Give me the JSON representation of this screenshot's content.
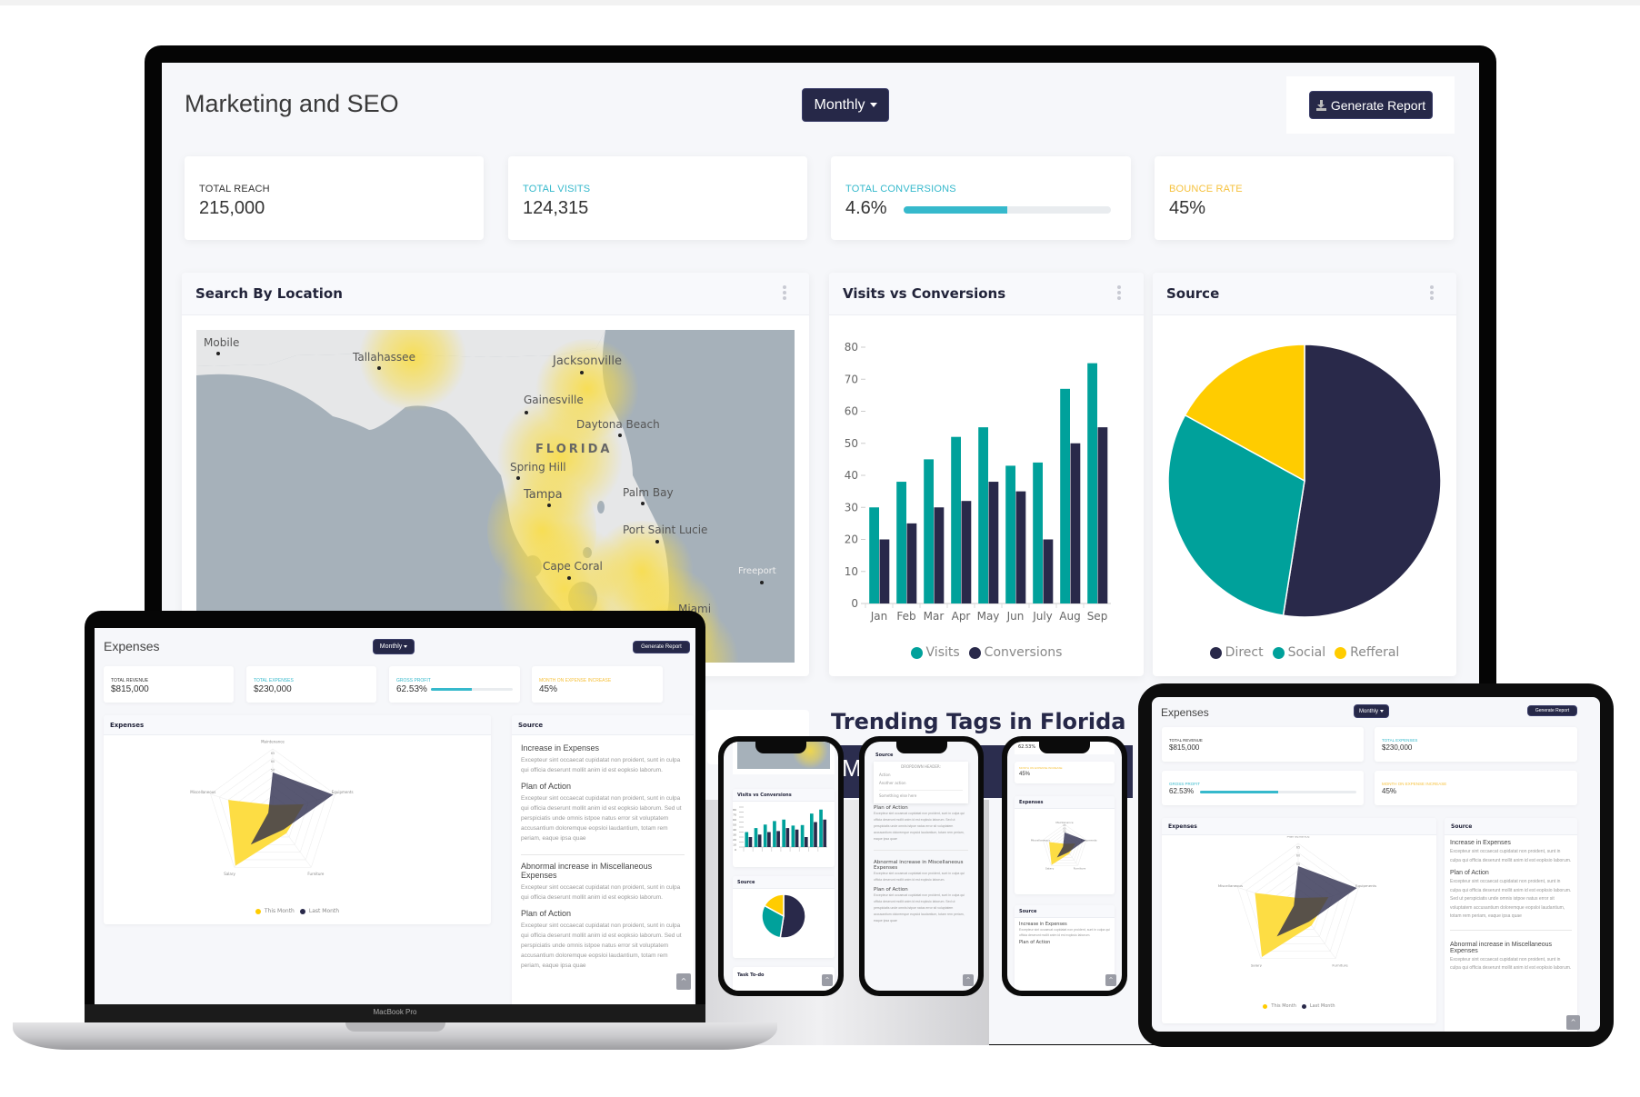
{
  "monitor": {
    "title": "Marketing and SEO",
    "period_button": "Monthly",
    "generate_button": "Generate Report",
    "stats": [
      {
        "label": "TOTAL REACH",
        "value": "215,000",
        "color": "#333333"
      },
      {
        "label": "TOTAL VISITS",
        "value": "124,315",
        "color": "#36b9cc"
      },
      {
        "label": "TOTAL CONVERSIONS",
        "value": "4.6%",
        "color": "#36b9cc",
        "progress_percent": 50
      },
      {
        "label": "BOUNCE RATE",
        "value": "45%",
        "color": "#f6c23e"
      }
    ],
    "map_panel": {
      "title": "Search By Location",
      "state_label": "FLORIDA",
      "cities": [
        "Mobile",
        "Tallahassee",
        "Jacksonville",
        "Gainesville",
        "Daytona Beach",
        "Spring Hill",
        "Tampa",
        "Palm Bay",
        "Port Saint Lucie",
        "Cape Coral",
        "Freeport",
        "Miami"
      ]
    },
    "trending": {
      "title": "Trending Tags in Florida",
      "banner_text": "M"
    }
  },
  "chart_data": [
    {
      "type": "bar",
      "title": "Visits vs Conversions",
      "categories": [
        "Jan",
        "Feb",
        "Mar",
        "Apr",
        "May",
        "Jun",
        "July",
        "Aug",
        "Sep"
      ],
      "series": [
        {
          "name": "Visits",
          "color": "#00a19b",
          "values": [
            30,
            38,
            45,
            52,
            55,
            43,
            44,
            67,
            75
          ]
        },
        {
          "name": "Conversions",
          "color": "#29294a",
          "values": [
            20,
            25,
            30,
            32,
            38,
            35,
            20,
            50,
            55
          ]
        }
      ],
      "yticks": [
        0,
        10,
        20,
        30,
        40,
        50,
        60,
        70,
        80
      ],
      "ylim": [
        0,
        80
      ],
      "legend": "bottom",
      "xlabel": "",
      "ylabel": ""
    },
    {
      "type": "pie",
      "title": "Source",
      "labels": [
        "Direct",
        "Social",
        "Refferal"
      ],
      "values": [
        52.5,
        30.5,
        17
      ],
      "colors": [
        "#29294a",
        "#00a19b",
        "#ffcc00"
      ],
      "legend": "bottom"
    },
    {
      "type": "radar",
      "title": "Expenses",
      "axes": [
        "Maintenance",
        "Equipments",
        "Furniture",
        "Salary",
        "Miscellaneous"
      ],
      "rticks": [
        50,
        60,
        65
      ],
      "series": [
        {
          "name": "This Month",
          "color": "#fddb3a",
          "values": [
            10,
            35,
            25,
            68,
            50
          ]
        },
        {
          "name": "Last Month",
          "color": "#29294a",
          "values": [
            45,
            68,
            20,
            40,
            5
          ]
        }
      ],
      "legend": "bottom"
    }
  ],
  "expenses_dashboard": {
    "title": "Expenses",
    "period_button": "Monthly",
    "generate_button": "Generate Report",
    "stats": [
      {
        "label": "TOTAL REVENUE",
        "value": "$815,000",
        "color": "#333333"
      },
      {
        "label": "TOTAL EXPENSES",
        "value": "$230,000",
        "color": "#36b9cc"
      },
      {
        "label": "GROSS PROFIT",
        "value": "62.53%",
        "color": "#36b9cc",
        "progress_percent": 50
      },
      {
        "label": "MONTH ON EXPENSE INCREASE",
        "value": "45%",
        "color": "#f6c23e"
      }
    ],
    "chart_panel_title": "Expenses",
    "source_panel": {
      "title": "Source",
      "sections": [
        {
          "heading": "Increase in Expenses",
          "body": "Excepteur sint occaecat cupidatat non proident, sunt in culpa qui officia deserunt mollit anim id est eopksio laborum."
        },
        {
          "heading": "Plan of Action",
          "body": "Excepteur sint occaecat cupidatat non proident, sunt in culpa qui officia deserunt mollit anim id est eopksio laborum. Sed ut perspiciatis unde omnis istpoe natus error sit voluptatem accusantium doloremque eopsloi laudantium, totam rem periam, eaque ipsa quae"
        },
        {
          "heading": "Abnormal increase in Miscellaneous Expenses",
          "body": "Excepteur sint occaecat cupidatat non proident, sunt in culpa qui officia deserunt mollit anim id est eopksio laborum."
        },
        {
          "heading": "Plan of Action",
          "body": "Excepteur sint occaecat cupidatat non proident, sunt in culpa qui officia deserunt mollit anim id est eopksio laborum. Sed ut perspiciatis unde omnis istpoe natus error sit voluptatem accusantium doloremque eopsloi laudantium, totam rem periam, eaque ipsa quae"
        }
      ]
    },
    "scroll_top_icon": "^"
  },
  "laptop": {
    "brand_label": "MacBook Pro"
  },
  "phones": {
    "phone1": {
      "panel1": "Visits vs Conversions",
      "panel2": "Source",
      "panel3": "Task To-do"
    },
    "phone2": {
      "panel_title": "Source",
      "dropdown_header": "DROPDOWN HEADER:",
      "dropdown_items": [
        "Action",
        "Another action",
        "Something else here"
      ],
      "section1": "Plan of Action",
      "section2": "Abnormal increase in Miscellaneous Expenses",
      "section3": "Plan of Action"
    },
    "phone3": {
      "top_value": "62.53%",
      "stat_label": "MONTH ON EXPENSE INCREASE",
      "stat_value": "45%",
      "panel1": "Expenses",
      "panel2": "Source",
      "section1": "Increase in Expenses",
      "section2": "Plan of Action"
    }
  },
  "colors": {
    "navy": "#262848",
    "teal": "#00a19b",
    "cyan": "#36b9cc",
    "yellow": "#ffcc00",
    "amber": "#f6c23e"
  }
}
